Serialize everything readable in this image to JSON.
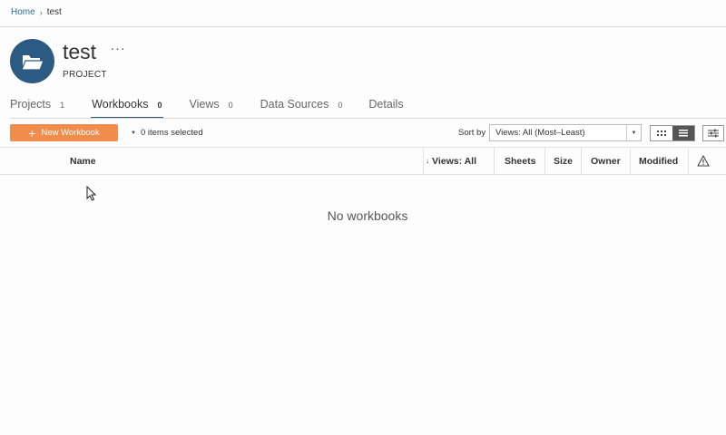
{
  "breadcrumb": {
    "home": "Home",
    "separator": "›",
    "current": "test"
  },
  "project": {
    "name": "test",
    "more": "···",
    "kind": "PROJECT",
    "avatar_icon": "folder-icon",
    "avatar_color": "#2b5b82"
  },
  "tabs": [
    {
      "label": "Projects",
      "count": "1",
      "active": false
    },
    {
      "label": "Workbooks",
      "count": "0",
      "active": true
    },
    {
      "label": "Views",
      "count": "0",
      "active": false
    },
    {
      "label": "Data Sources",
      "count": "0",
      "active": false
    },
    {
      "label": "Details",
      "count": "",
      "active": false
    }
  ],
  "toolbar": {
    "new_label": "New Workbook",
    "new_color": "#f18c4c",
    "selection": "0 items selected",
    "sort_label": "Sort by",
    "sort_value": "Views: All (Most–Least)",
    "view_mode": "list"
  },
  "table": {
    "columns": {
      "name": "Name",
      "views": "Views: All",
      "views_sort_icon": "↓",
      "sheets": "Sheets",
      "size": "Size",
      "owner": "Owner",
      "modified": "Modified",
      "alert_icon": "warning-icon"
    },
    "empty_message": "No workbooks"
  }
}
